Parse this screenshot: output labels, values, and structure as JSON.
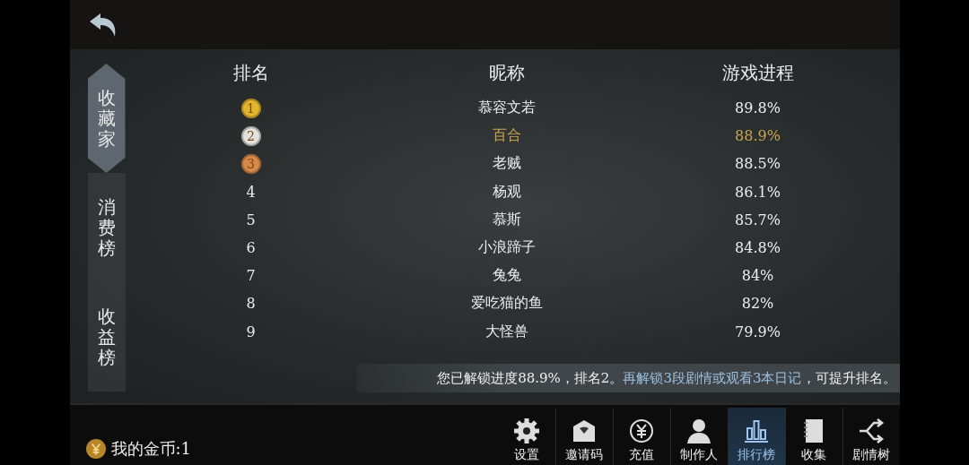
{
  "side_tabs": [
    {
      "label": "收藏家",
      "selected": true
    },
    {
      "label": "消费榜",
      "selected": false
    },
    {
      "label": "收益榜",
      "selected": false
    }
  ],
  "table": {
    "columns": [
      "排名",
      "昵称",
      "游戏进程"
    ],
    "rows": [
      {
        "rank": "1",
        "kind": "medal",
        "color": "#e2b52c",
        "name": "慕容文若",
        "progress": "89.8%",
        "selected": false
      },
      {
        "rank": "2",
        "kind": "medal",
        "color": "#e4e2dc",
        "name": "百合",
        "progress": "88.9%",
        "selected": true
      },
      {
        "rank": "3",
        "kind": "medal",
        "color": "#d98a4a",
        "name": "老贼",
        "progress": "88.5%",
        "selected": false
      },
      {
        "rank": "4",
        "kind": "plain",
        "name": "杨观",
        "progress": "86.1%",
        "selected": false
      },
      {
        "rank": "5",
        "kind": "plain",
        "name": "慕斯",
        "progress": "85.7%",
        "selected": false
      },
      {
        "rank": "6",
        "kind": "plain",
        "name": "小浪蹄子",
        "progress": "84.8%",
        "selected": false
      },
      {
        "rank": "7",
        "kind": "plain",
        "name": "兔兔",
        "progress": "84%",
        "selected": false
      },
      {
        "rank": "8",
        "kind": "plain",
        "name": "爱吃猫的鱼",
        "progress": "82%",
        "selected": false
      },
      {
        "rank": "9",
        "kind": "plain",
        "name": "大怪兽",
        "progress": "79.9%",
        "selected": false
      }
    ]
  },
  "notice": {
    "text": "您已解锁进度88.9%，排名2。",
    "hint": "再解锁3段剧情或观看3本日记",
    "suffix": "，可提升排名。"
  },
  "coins": {
    "label": "我的金币:1"
  },
  "nav": [
    {
      "label": "设置",
      "selected": false
    },
    {
      "label": "邀请码",
      "selected": false
    },
    {
      "label": "充值",
      "selected": false
    },
    {
      "label": "制作人",
      "selected": false
    },
    {
      "label": "排行榜",
      "selected": true
    },
    {
      "label": "收集",
      "selected": false
    },
    {
      "label": "剧情树",
      "selected": false
    }
  ]
}
